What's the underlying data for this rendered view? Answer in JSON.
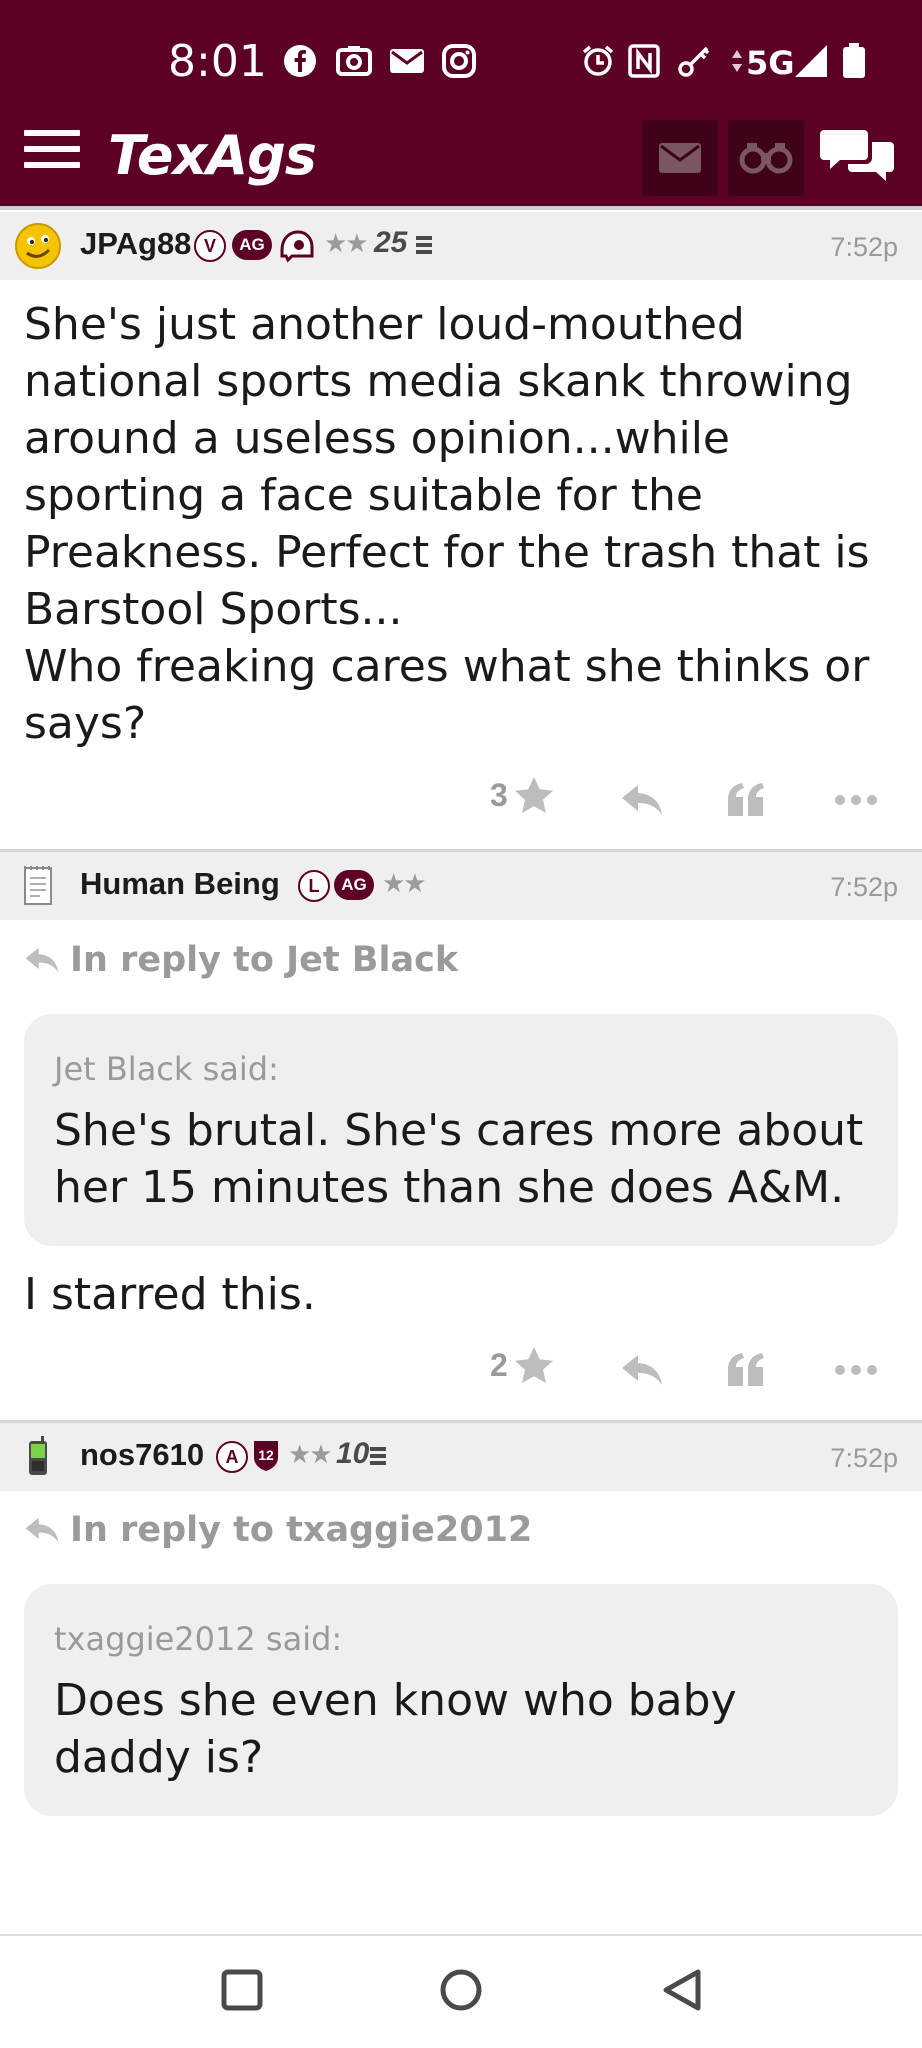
{
  "status_bar": {
    "time": "8:01",
    "network": "5G",
    "left_icons": [
      "facebook-icon",
      "camera-icon",
      "mail-icon",
      "instagram-icon"
    ],
    "right_icons": [
      "alarm-icon",
      "nfc-icon",
      "key-icon",
      "signal-icon",
      "battery-icon"
    ]
  },
  "app_bar": {
    "logo": "TexAgs",
    "buttons": [
      "menu-icon",
      "messages-icon",
      "watching-icon",
      "chat-icon"
    ]
  },
  "colors": {
    "brand": "#5c0025",
    "header_bg": "#efefef",
    "muted_text": "#9a9a9a"
  },
  "posts": [
    {
      "username": "JPAg88",
      "badge_circle": "V",
      "badge_pill": "AG",
      "stars": "★★",
      "rank": "25",
      "time": "7:52p",
      "body": "She's just another loud-mouthed national sports media skank throwing around a useless opinion...while sporting a face suitable for the Preakness. Perfect for the trash that is Barstool Sports...",
      "body2": "Who freaking cares what she thinks or says?",
      "star_count": "3"
    },
    {
      "username": "Human Being",
      "badge_circle": "L",
      "badge_pill": "AG",
      "stars": "★★",
      "time": "7:52p",
      "reply_to": "In reply to Jet Black",
      "quote_author": "Jet Black said:",
      "quote_text": "She's brutal. She's cares more about her 15 minutes than she does A&M.",
      "body": "I starred this.",
      "star_count": "2"
    },
    {
      "username": "nos7610",
      "badge_circle": "A",
      "badge_shield": "12",
      "stars": "★★",
      "rank": "10",
      "time": "7:52p",
      "reply_to": "In reply to txaggie2012",
      "quote_author": "txaggie2012 said:",
      "quote_text": "Does she even know who baby daddy is?"
    }
  ],
  "nav_bar": {
    "buttons": [
      "recents-button",
      "home-button",
      "back-button"
    ]
  }
}
